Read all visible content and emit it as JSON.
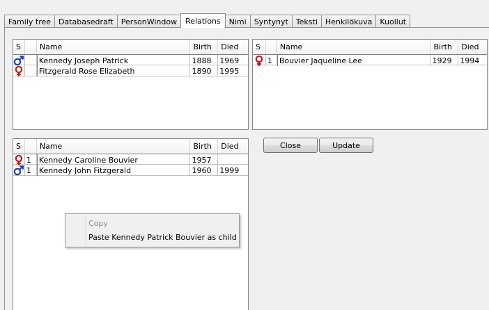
{
  "tabs": [
    {
      "label": "Family tree",
      "active": false
    },
    {
      "label": "Databasedraft",
      "active": false
    },
    {
      "label": "PersonWindow",
      "active": false
    },
    {
      "label": "Relations",
      "active": true
    },
    {
      "label": "Nimi",
      "active": false
    },
    {
      "label": "Syntynyt",
      "active": false
    },
    {
      "label": "Teksti",
      "active": false
    },
    {
      "label": "Henkilökuva",
      "active": false
    },
    {
      "label": "Kuollut",
      "active": false
    }
  ],
  "parents_table": {
    "headers": {
      "sex": "S",
      "num": "",
      "name": "Name",
      "birth": "Birth",
      "died": "Died"
    },
    "rows": [
      {
        "sex": "male",
        "num": "",
        "name": "Kennedy Joseph Patrick",
        "birth": "1888",
        "died": "1969"
      },
      {
        "sex": "female",
        "num": "",
        "name": "Fitzgerald Rose Elizabeth",
        "birth": "1890",
        "died": "1995"
      }
    ]
  },
  "spouses_table": {
    "headers": {
      "sex": "S",
      "num": "",
      "name": "Name",
      "birth": "Birth",
      "died": "Died"
    },
    "rows": [
      {
        "sex": "female",
        "num": "1",
        "name": "Bouvier Jaqueline Lee",
        "birth": "1929",
        "died": "1994"
      }
    ]
  },
  "children_table": {
    "headers": {
      "sex": "S",
      "num": "",
      "name": "Name",
      "birth": "Birth",
      "died": "Died"
    },
    "rows": [
      {
        "sex": "female",
        "num": "1",
        "name": "Kennedy Caroline Bouvier",
        "birth": "1957",
        "died": ""
      },
      {
        "sex": "male",
        "num": "1",
        "name": "Kennedy John Fitzgerald",
        "birth": "1960",
        "died": "1999"
      }
    ]
  },
  "buttons": {
    "close": "Close",
    "update": "Update"
  },
  "context_menu": {
    "copy": "Copy",
    "paste": "Paste Kennedy Patrick Bouvier as child"
  },
  "colors": {
    "male": "#1d3fb5",
    "female": "#d01414"
  }
}
